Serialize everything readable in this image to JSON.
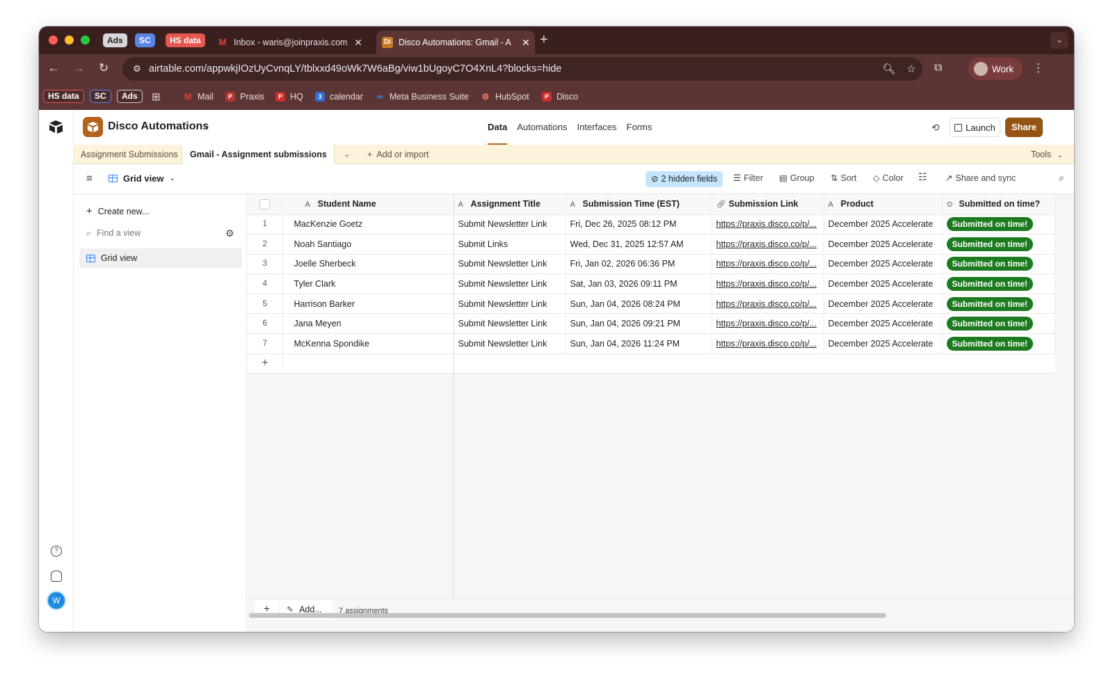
{
  "browser": {
    "tab_pills": [
      "Ads",
      "SC",
      "HS data"
    ],
    "tabs": [
      {
        "label": "Inbox - waris@joinpraxis.com",
        "icon": "gmail-icon"
      },
      {
        "label": "Disco Automations: Gmail - A",
        "icon": "airtable-base-icon",
        "icon_text": "Di"
      }
    ],
    "url": "airtable.com/appwkjIOzUyCvnqLY/tblxxd49oWk7W6aBg/viw1bUgoyC7O4XnL4?blocks=hide",
    "profile_label": "Work",
    "bookmarks": {
      "pills": [
        "HS data",
        "SC",
        "Ads"
      ],
      "items": [
        "Mail",
        "Praxis",
        "HQ",
        "calendar",
        "Meta Business Suite",
        "HubSpot",
        "Disco"
      ]
    }
  },
  "base": {
    "name": "Disco Automations",
    "nav": [
      "Data",
      "Automations",
      "Interfaces",
      "Forms"
    ],
    "active_nav": "Data",
    "launch_label": "Launch",
    "share_label": "Share"
  },
  "tables": {
    "tab1": "Assignment Submissions",
    "tab2": "Gmail - Assignment submissions",
    "add_label": "Add or import",
    "tools_label": "Tools"
  },
  "viewbar": {
    "view_name": "Grid view",
    "hidden_fields": "2 hidden fields",
    "filter": "Filter",
    "group": "Group",
    "sort": "Sort",
    "color": "Color",
    "share_sync": "Share and sync"
  },
  "sidebar": {
    "create": "Create new...",
    "find_placeholder": "Find a view",
    "grid_view": "Grid view"
  },
  "grid": {
    "columns": [
      "Student Name",
      "Assignment Title",
      "Submission Time (EST)",
      "Submission Link",
      "Product",
      "Submitted on time?"
    ],
    "rows": [
      {
        "no": "1",
        "name": "MacKenzie Goetz",
        "title": "Submit Newsletter Link",
        "time": "Fri, Dec 26, 2025 08:12 PM",
        "link": "https://praxis.disco.co/p/...",
        "product": "December 2025 Accelerate",
        "status": "Submitted on time!"
      },
      {
        "no": "2",
        "name": "Noah Santiago",
        "title": "Submit Links",
        "time": "Wed, Dec 31, 2025 12:57 AM",
        "link": "https://praxis.disco.co/p/...",
        "product": "December 2025 Accelerate",
        "status": "Submitted on time!"
      },
      {
        "no": "3",
        "name": "Joelle Sherbeck",
        "title": "Submit Newsletter Link",
        "time": "Fri, Jan 02, 2026 06:36 PM",
        "link": "https://praxis.disco.co/p/...",
        "product": "December 2025 Accelerate",
        "status": "Submitted on time!"
      },
      {
        "no": "4",
        "name": "Tyler Clark",
        "title": "Submit Newsletter Link",
        "time": "Sat, Jan 03, 2026 09:11 PM",
        "link": "https://praxis.disco.co/p/...",
        "product": "December 2025 Accelerate",
        "status": "Submitted on time!"
      },
      {
        "no": "5",
        "name": "Harrison Barker",
        "title": "Submit Newsletter Link",
        "time": "Sun, Jan 04, 2026 08:24 PM",
        "link": "https://praxis.disco.co/p/...",
        "product": "December 2025 Accelerate",
        "status": "Submitted on time!"
      },
      {
        "no": "6",
        "name": "Jana Meyen",
        "title": "Submit Newsletter Link",
        "time": "Sun, Jan 04, 2026 09:21 PM",
        "link": "https://praxis.disco.co/p/...",
        "product": "December 2025 Accelerate",
        "status": "Submitted on time!"
      },
      {
        "no": "7",
        "name": "McKenna Spondike",
        "title": "Submit Newsletter Link",
        "time": "Sun, Jan 04, 2026 11:24 PM",
        "link": "https://praxis.disco.co/p/...",
        "product": "December 2025 Accelerate",
        "status": "Submitted on time!"
      }
    ],
    "add_label": "Add...",
    "record_count": "7 assignments"
  },
  "colors": {
    "chrome_dark": "#3a1f1f",
    "chrome": "#5b3535",
    "accent": "#955315",
    "status_green": "#1d7b1f",
    "tablebar_bg": "#fcf3da"
  }
}
